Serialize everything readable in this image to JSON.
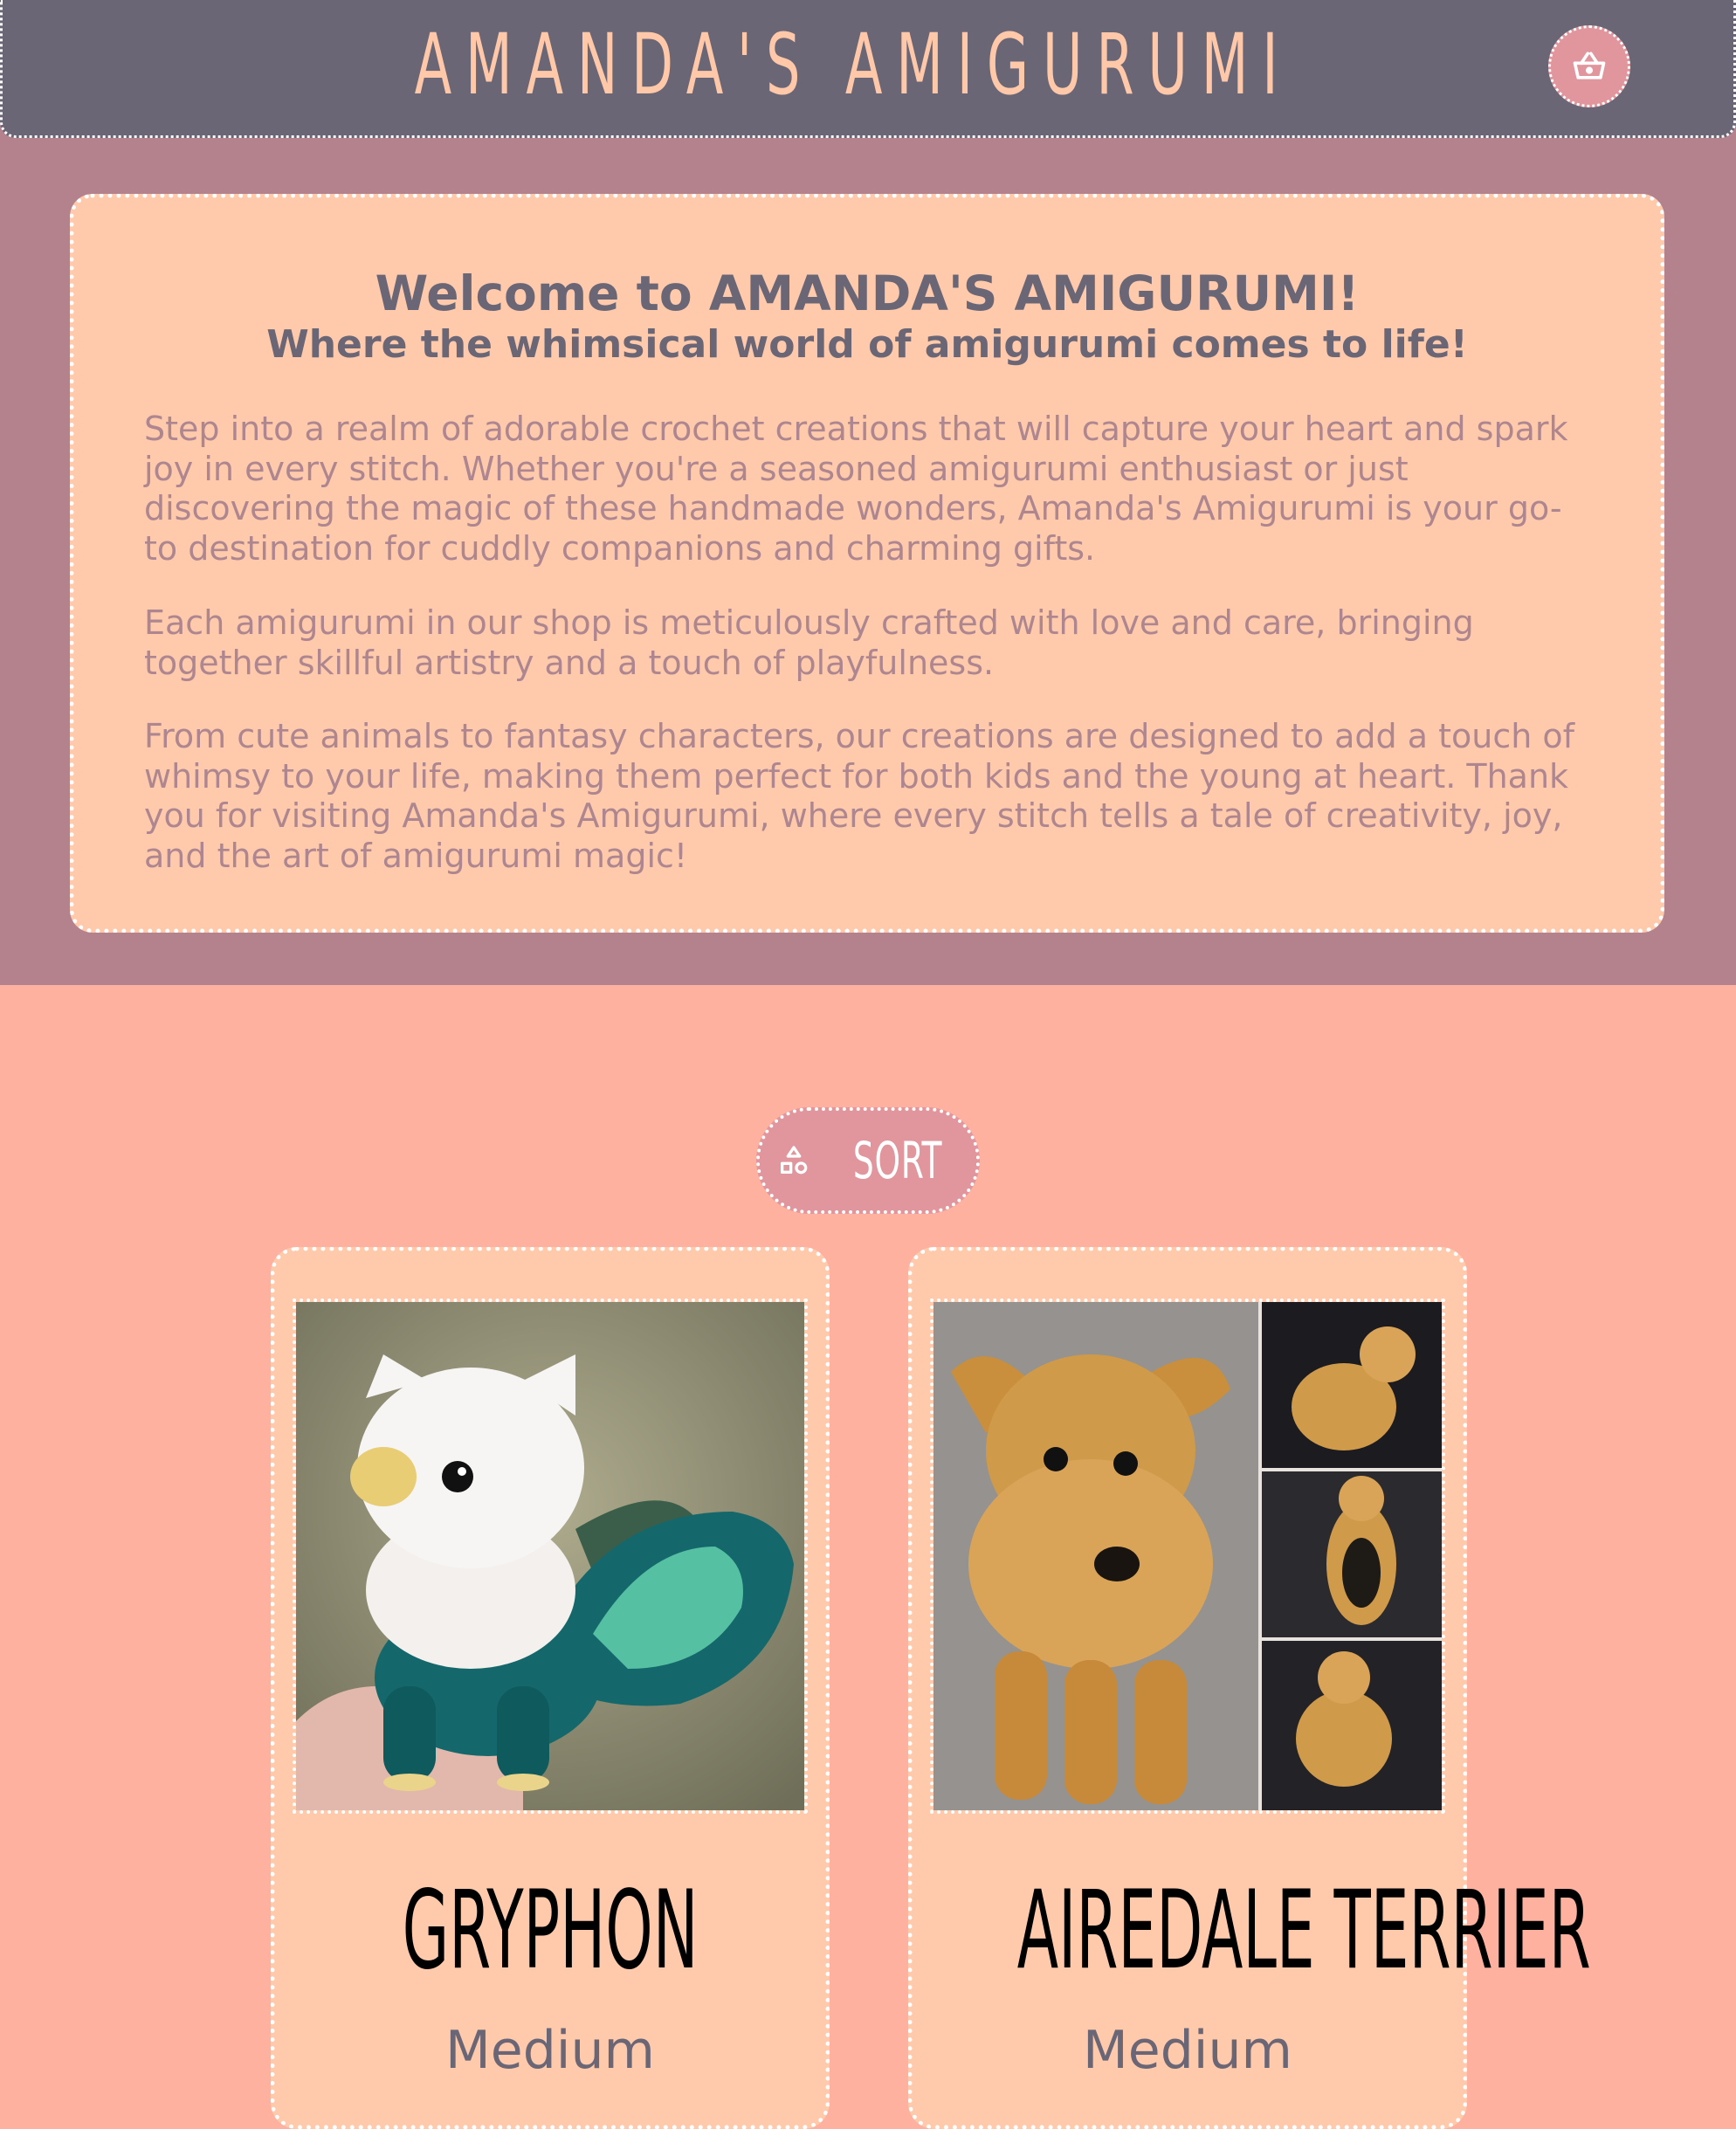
{
  "header": {
    "site_title": "AMANDA'S AMIGURUMI",
    "cart_icon": "basket-icon"
  },
  "intro": {
    "heading": "Welcome to AMANDA'S AMIGURUMI!",
    "subheading": "Where the whimsical world of amigurumi comes to life!",
    "paragraphs": [
      "Step into a realm of adorable crochet creations that will capture your heart and spark joy in every stitch. Whether you're a seasoned amigurumi enthusiast or just discovering the magic of these handmade wonders, Amanda's Amigurumi is your go-to destination for cuddly companions and charming gifts.",
      "Each amigurumi in our shop is meticulously crafted with love and care, bringing together skillful artistry and a touch of playfulness.",
      "From cute animals to fantasy characters, our creations are designed to add a touch of whimsy to your life, making them perfect for both kids and the young at heart. Thank you for visiting Amanda's Amigurumi, where every stitch tells a tale of creativity, joy, and the art of amigurumi magic!"
    ]
  },
  "sort": {
    "label": "SORT",
    "icon": "shapes-icon"
  },
  "products": [
    {
      "name": "GRYPHON",
      "size": "Medium"
    },
    {
      "name": "AIREDALE TERRIER",
      "size": "Medium"
    }
  ],
  "colors": {
    "header_bg": "#6b6676",
    "title": "#ffc8a8",
    "intro_band": "#b3828c",
    "card_bg": "#ffcaab",
    "page_bg": "#ffb19f",
    "accent_button": "#e0969c",
    "intro_text": "#ae8690"
  }
}
